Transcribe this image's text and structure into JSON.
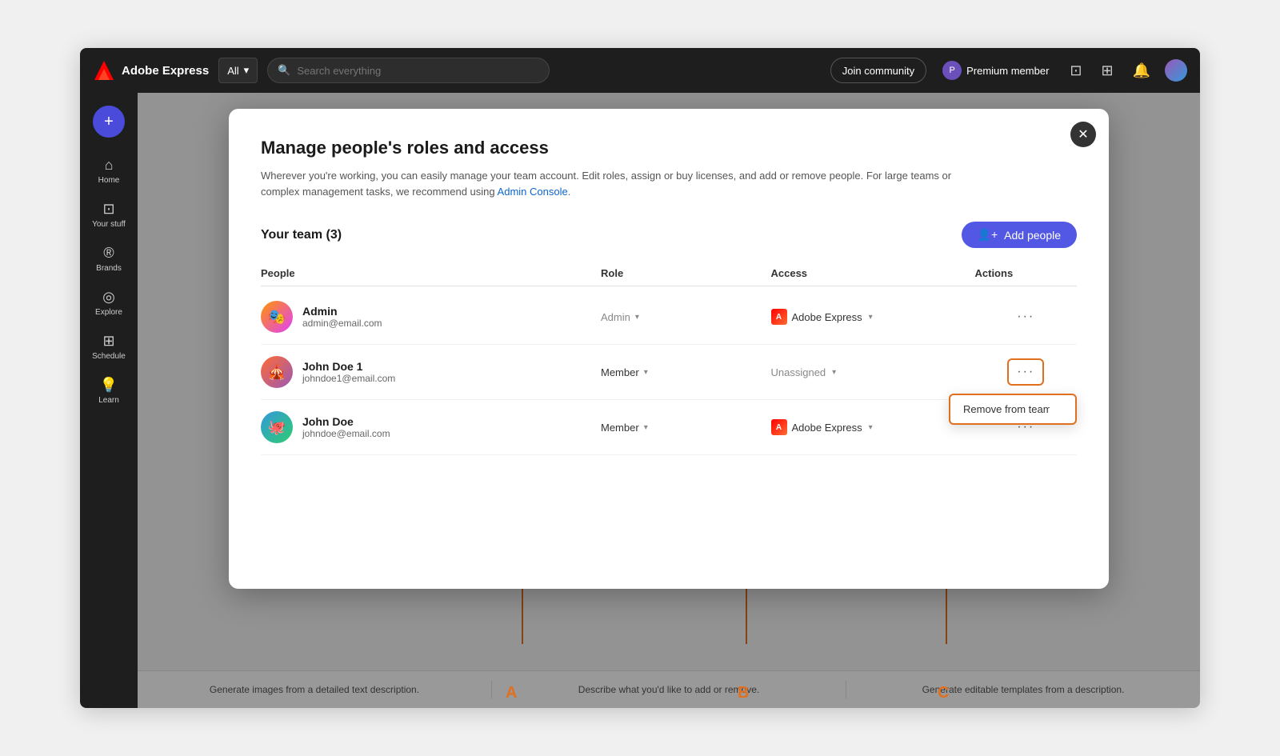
{
  "navbar": {
    "logo_text": "Adobe Express",
    "search_placeholder": "Search everything",
    "dropdown_label": "All",
    "join_community": "Join community",
    "premium_member": "Premium member"
  },
  "sidebar": {
    "add_label": "+",
    "items": [
      {
        "label": "Home",
        "icon": "⌂"
      },
      {
        "label": "Your stuff",
        "icon": "⊡"
      },
      {
        "label": "Brands",
        "icon": "®"
      },
      {
        "label": "Explore",
        "icon": "◎"
      },
      {
        "label": "Schedule",
        "icon": "⊞"
      },
      {
        "label": "Learn",
        "icon": "💡"
      }
    ]
  },
  "modal": {
    "title": "Manage people's roles and access",
    "description": "Wherever you're working, you can easily manage your team account. Edit roles, assign or buy licenses, and add or remove people. For large teams or complex management tasks, we recommend using",
    "admin_console_link": "Admin Console",
    "team_label": "Your team (3)",
    "add_people_label": "Add people",
    "table": {
      "headers": [
        "People",
        "Role",
        "Access",
        "Actions"
      ],
      "rows": [
        {
          "name": "Admin",
          "email": "admin@email.com",
          "role": "Admin",
          "access": "Adobe Express",
          "has_access_logo": true,
          "is_unassigned": false,
          "avatar_emoji": "🎭"
        },
        {
          "name": "John Doe 1",
          "email": "johndoe1@email.com",
          "role": "Member",
          "access": "Unassigned",
          "has_access_logo": false,
          "is_unassigned": true,
          "avatar_emoji": "🎪",
          "show_dropdown": true,
          "dropdown_items": [
            "Remove from team"
          ]
        },
        {
          "name": "John Doe",
          "email": "johndoe@email.com",
          "role": "Member",
          "access": "Adobe Express",
          "has_access_logo": true,
          "is_unassigned": false,
          "avatar_emoji": "🐙"
        }
      ]
    }
  },
  "bottom_bar": {
    "items": [
      "Generate images from a detailed text description.",
      "Describe what you'd like to add or remove.",
      "Generate editable templates from a description."
    ]
  },
  "annotations": {
    "a_label": "A",
    "b_label": "B",
    "c_label": "C"
  }
}
